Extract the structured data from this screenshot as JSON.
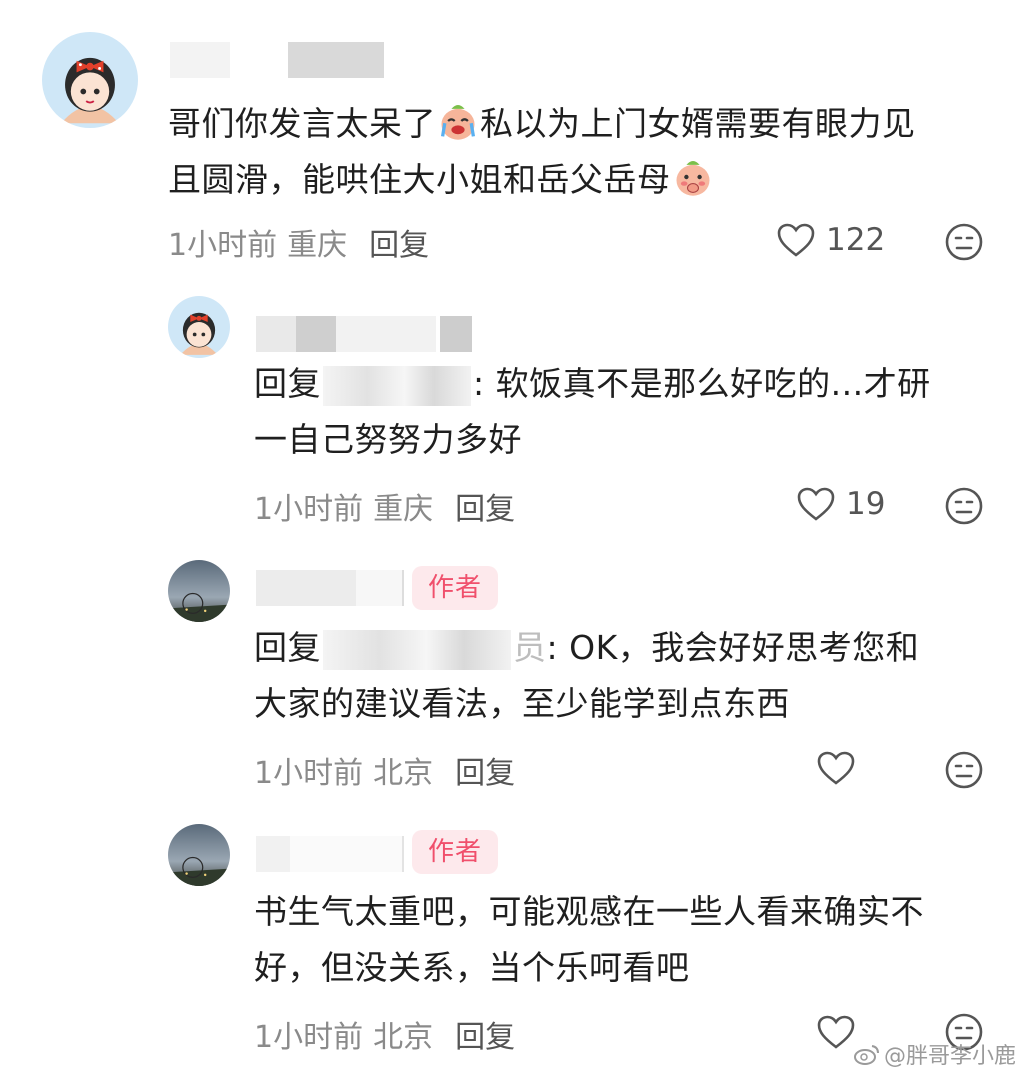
{
  "comments": [
    {
      "text_line1_a": "哥们你发言太呆了",
      "text_line1_b": "私以为上门女婿需要有眼力见",
      "text_line2": "且圆滑，能哄住大小姐和岳父岳母",
      "time": "1小时前",
      "location": "重庆",
      "reply": "回复",
      "likes": "122"
    },
    {
      "prefix": "回复",
      "text_line1": ": 软饭真不是那么好吃的...才研",
      "text_line2": "一自己努努力多好",
      "time": "1小时前",
      "location": "重庆",
      "reply": "回复",
      "likes": "19"
    },
    {
      "badge": "作者",
      "prefix": "回复",
      "masked_tail": "员",
      "text_line1": ": OK，我会好好思考您和",
      "text_line2": "大家的建议看法，至少能学到点东西",
      "time": "1小时前",
      "location": "北京",
      "reply": "回复"
    },
    {
      "badge": "作者",
      "text_line1": "书生气太重吧，可能观感在一些人看来确实不",
      "text_line2": "好，但没关系，当个乐呵看吧",
      "time": "1小时前",
      "location": "北京",
      "reply": "回复"
    }
  ],
  "watermark": "@胖哥李小鹿",
  "icons": [
    "heart-icon",
    "dislike-face-icon",
    "crying-emoji-icon",
    "shy-emoji-icon"
  ]
}
